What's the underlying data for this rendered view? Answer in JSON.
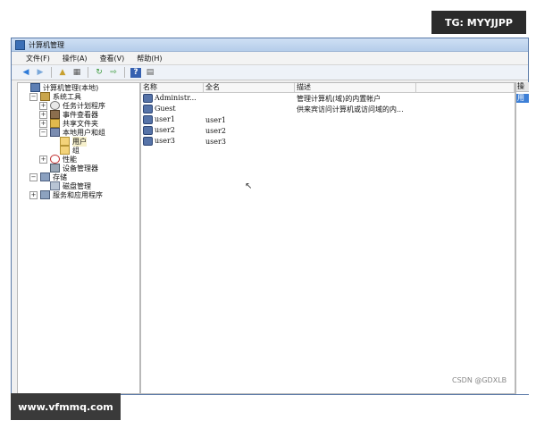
{
  "watermarks": {
    "top": "TG: MYYJJPP",
    "bottom": "www.vfmmq.com",
    "csdn": "CSDN @GDXLB"
  },
  "window": {
    "title": "计算机管理"
  },
  "menu": {
    "items": [
      "文件(F)",
      "操作(A)",
      "查看(V)",
      "帮助(H)"
    ]
  },
  "toolbar": {
    "icons": [
      "back-icon",
      "forward-icon",
      "up-icon",
      "show-hide-tree-icon",
      "refresh-icon",
      "export-icon",
      "help-icon",
      "show-hide-action-icon"
    ]
  },
  "tree": {
    "items": [
      {
        "label": "计算机管理(本地)",
        "depth": 0,
        "expander": "",
        "icon": "computer-icon"
      },
      {
        "label": "系统工具",
        "depth": 1,
        "expander": "−",
        "icon": "tools-icon"
      },
      {
        "label": "任务计划程序",
        "depth": 2,
        "expander": "+",
        "icon": "clock-icon"
      },
      {
        "label": "事件查看器",
        "depth": 2,
        "expander": "+",
        "icon": "event-log-icon"
      },
      {
        "label": "共享文件夹",
        "depth": 2,
        "expander": "+",
        "icon": "shared-folder-icon"
      },
      {
        "label": "本地用户和组",
        "depth": 2,
        "expander": "−",
        "icon": "users-icon"
      },
      {
        "label": "用户",
        "depth": 3,
        "expander": "",
        "icon": "folder-icon",
        "selected": true
      },
      {
        "label": "组",
        "depth": 3,
        "expander": "",
        "icon": "folder-icon"
      },
      {
        "label": "性能",
        "depth": 2,
        "expander": "+",
        "icon": "performance-icon"
      },
      {
        "label": "设备管理器",
        "depth": 2,
        "expander": "",
        "icon": "device-manager-icon"
      },
      {
        "label": "存储",
        "depth": 1,
        "expander": "−",
        "icon": "storage-icon"
      },
      {
        "label": "磁盘管理",
        "depth": 2,
        "expander": "",
        "icon": "disk-icon"
      },
      {
        "label": "服务和应用程序",
        "depth": 1,
        "expander": "+",
        "icon": "services-icon"
      }
    ]
  },
  "list": {
    "columns": [
      "名称",
      "全名",
      "描述",
      ""
    ],
    "rows": [
      {
        "name": "Administr...",
        "fullname": "",
        "description": "管理计算机(域)的内置帐户"
      },
      {
        "name": "Guest",
        "fullname": "",
        "description": "供来宾访问计算机或访问域的内..."
      },
      {
        "name": "user1",
        "fullname": "user1",
        "description": ""
      },
      {
        "name": "user2",
        "fullname": "user2",
        "description": ""
      },
      {
        "name": "user3",
        "fullname": "user3",
        "description": ""
      }
    ]
  },
  "actions": {
    "header": "操",
    "item": "用"
  },
  "colors": {
    "titlebar": "#b5cdea",
    "selection": "#3d7fd6"
  }
}
